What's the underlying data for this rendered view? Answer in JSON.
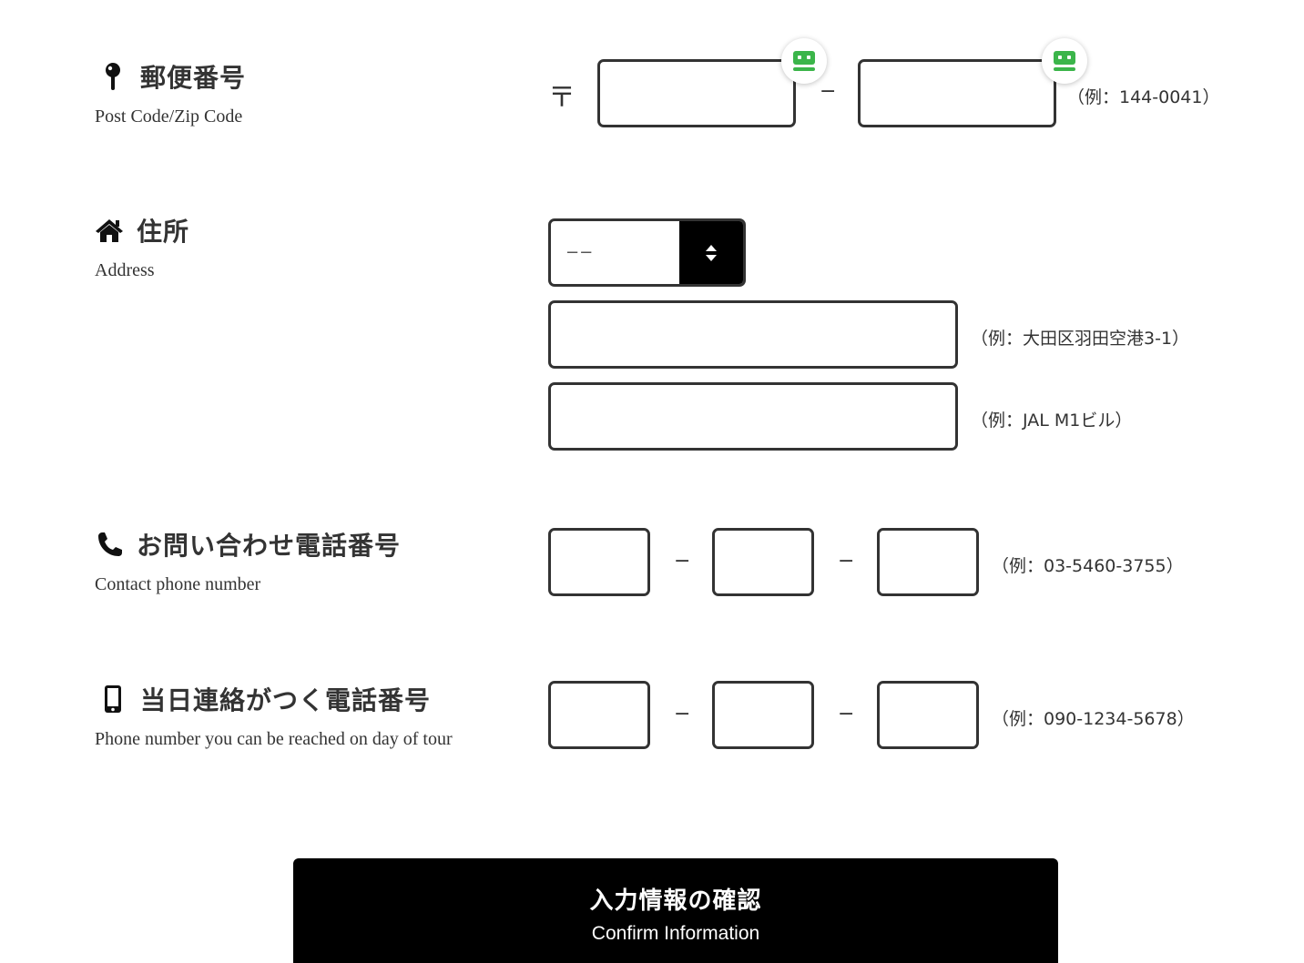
{
  "postcode": {
    "label_ja": "郵便番号",
    "label_en": "Post Code/Zip Code",
    "icon": "map-pin-icon",
    "postal_mark": "〒",
    "separator": "−",
    "hint": "（例：144-0041）",
    "part1_value": "",
    "part2_value": "",
    "autofill_icon": "password-manager-icon",
    "autofill_color": "#3bb54a"
  },
  "address": {
    "label_ja": "住所",
    "label_en": "Address",
    "icon": "home-icon",
    "prefecture_selected": "−−",
    "line1_value": "",
    "line1_hint": "（例：大田区羽田空港3-1）",
    "line2_value": "",
    "line2_hint": "（例：JAL M1ビル）"
  },
  "contact_phone": {
    "label_ja": "お問い合わせ電話番号",
    "label_en": "Contact phone number",
    "icon": "phone-icon",
    "separator": "−",
    "hint": "（例：03-5460-3755）",
    "parts": [
      "",
      "",
      ""
    ]
  },
  "day_phone": {
    "label_ja": "当日連絡がつく電話番号",
    "label_en": "Phone number you can be reached on day of tour",
    "icon": "mobile-phone-icon",
    "separator": "−",
    "hint": "（例：090-1234-5678）",
    "parts": [
      "",
      "",
      ""
    ]
  },
  "confirm": {
    "label_ja": "入力情報の確認",
    "label_en": "Confirm Information"
  },
  "colors": {
    "text": "#333333",
    "button_bg": "#000000",
    "button_text": "#ffffff"
  }
}
